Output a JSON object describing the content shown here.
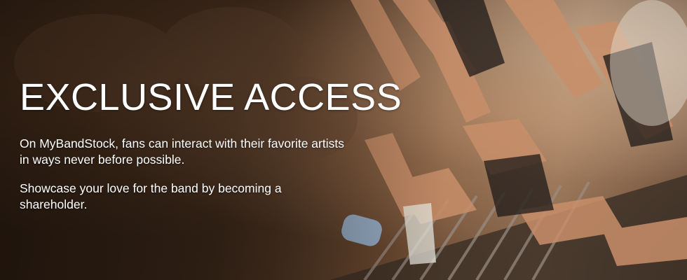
{
  "hero": {
    "headline": "EXCLUSIVE ACCESS",
    "paragraphs": [
      "On MyBandStock, fans can interact with their favorite artists in ways never before possible.",
      "Showcase your love for the band by becoming a shareholder."
    ]
  },
  "colors": {
    "text": "#ffffff",
    "background_dark": "#2b1d13",
    "background_warm": "#8a6a50"
  }
}
